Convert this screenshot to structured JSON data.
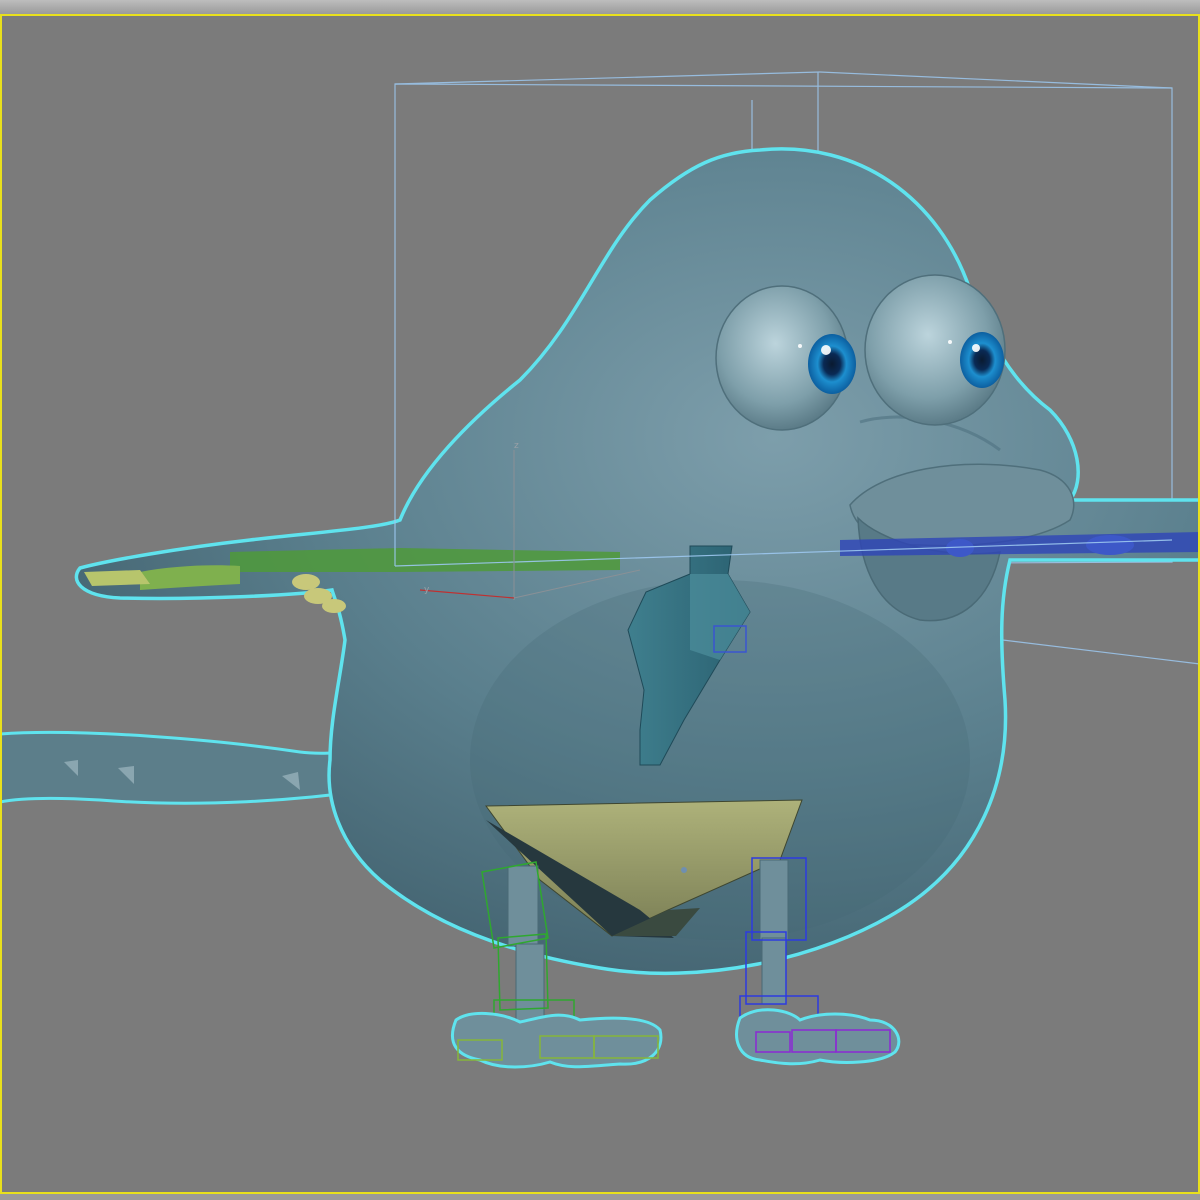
{
  "viewport": {
    "active_border_color": "#e8e01c",
    "background_color": "#7b7b7b",
    "selection_outline_color": "#5fe3ee",
    "bounding_box_color": "#9cc8f0"
  },
  "gizmo": {
    "z_label": "z",
    "y_label": "y"
  },
  "character": {
    "body_color": "#5a7f8d",
    "iris_color": "#1d8fcf",
    "rig_colors": {
      "left_arm": "#5fa33c",
      "right_arm": "#2e45b8",
      "pelvis": "#c8c474",
      "left_leg": "#2fa82f",
      "right_leg": "#2d3be0",
      "right_foot": "#8a2fd0"
    }
  }
}
